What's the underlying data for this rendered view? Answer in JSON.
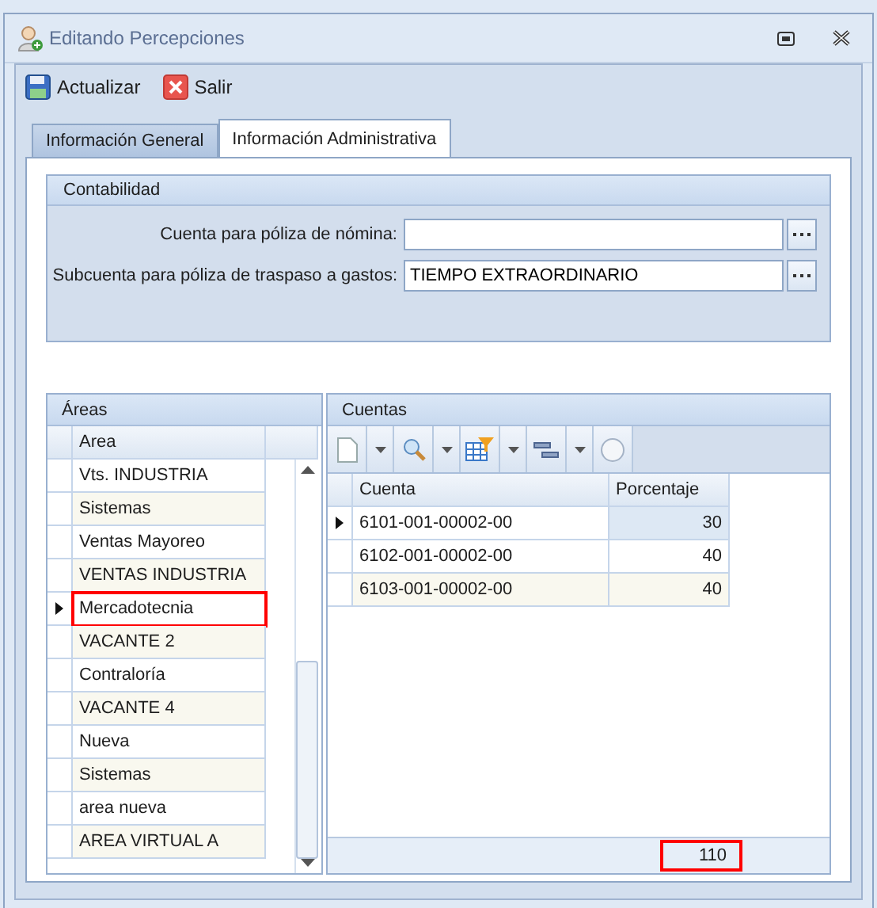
{
  "window": {
    "title": "Editando Percepciones"
  },
  "toolbar": [
    {
      "label": "Actualizar",
      "kind": "save"
    },
    {
      "label": "Salir",
      "kind": "exit"
    }
  ],
  "tabs": [
    {
      "label": "Información General",
      "selected": false
    },
    {
      "label": "Información Administrativa",
      "selected": true
    }
  ],
  "contabilidad": {
    "title": "Contabilidad",
    "fields": [
      {
        "label": "Cuenta para póliza de nómina:"
      },
      {
        "label": "Subcuenta para póliza de traspaso a gastos:",
        "value": "TIEMPO EXTRAORDINARIO"
      }
    ]
  },
  "areas": {
    "title": "Áreas",
    "column": "Area",
    "rows": [
      {
        "name": "Vts. INDUSTRIA",
        "selected": false,
        "highlighted": false
      },
      {
        "name": "Sistemas",
        "selected": false,
        "highlighted": false
      },
      {
        "name": "Ventas Mayoreo",
        "selected": false,
        "highlighted": false
      },
      {
        "name": "VENTAS INDUSTRIA",
        "selected": false,
        "highlighted": false
      },
      {
        "name": "Mercadotecnia",
        "selected": true,
        "highlighted": true
      },
      {
        "name": "VACANTE 2",
        "selected": false,
        "highlighted": false
      },
      {
        "name": "Contraloría",
        "selected": false,
        "highlighted": false
      },
      {
        "name": "VACANTE 4",
        "selected": false,
        "highlighted": false
      },
      {
        "name": "Nueva",
        "selected": false,
        "highlighted": false
      },
      {
        "name": "Sistemas",
        "selected": false,
        "highlighted": false
      },
      {
        "name": "area nueva",
        "selected": false,
        "highlighted": false
      },
      {
        "name": "AREA VIRTUAL A",
        "selected": false,
        "highlighted": false
      }
    ]
  },
  "cuentas": {
    "title": "Cuentas",
    "columns": [
      "Cuenta",
      "Porcentaje"
    ],
    "rows": [
      {
        "cuenta": "6101-001-00002-00",
        "porcentaje": "30",
        "selected": true
      },
      {
        "cuenta": "6102-001-00002-00",
        "porcentaje": "40",
        "selected": false
      },
      {
        "cuenta": "6103-001-00002-00",
        "porcentaje": "40",
        "selected": false
      }
    ],
    "total": {
      "value": "110",
      "highlighted": true
    }
  }
}
